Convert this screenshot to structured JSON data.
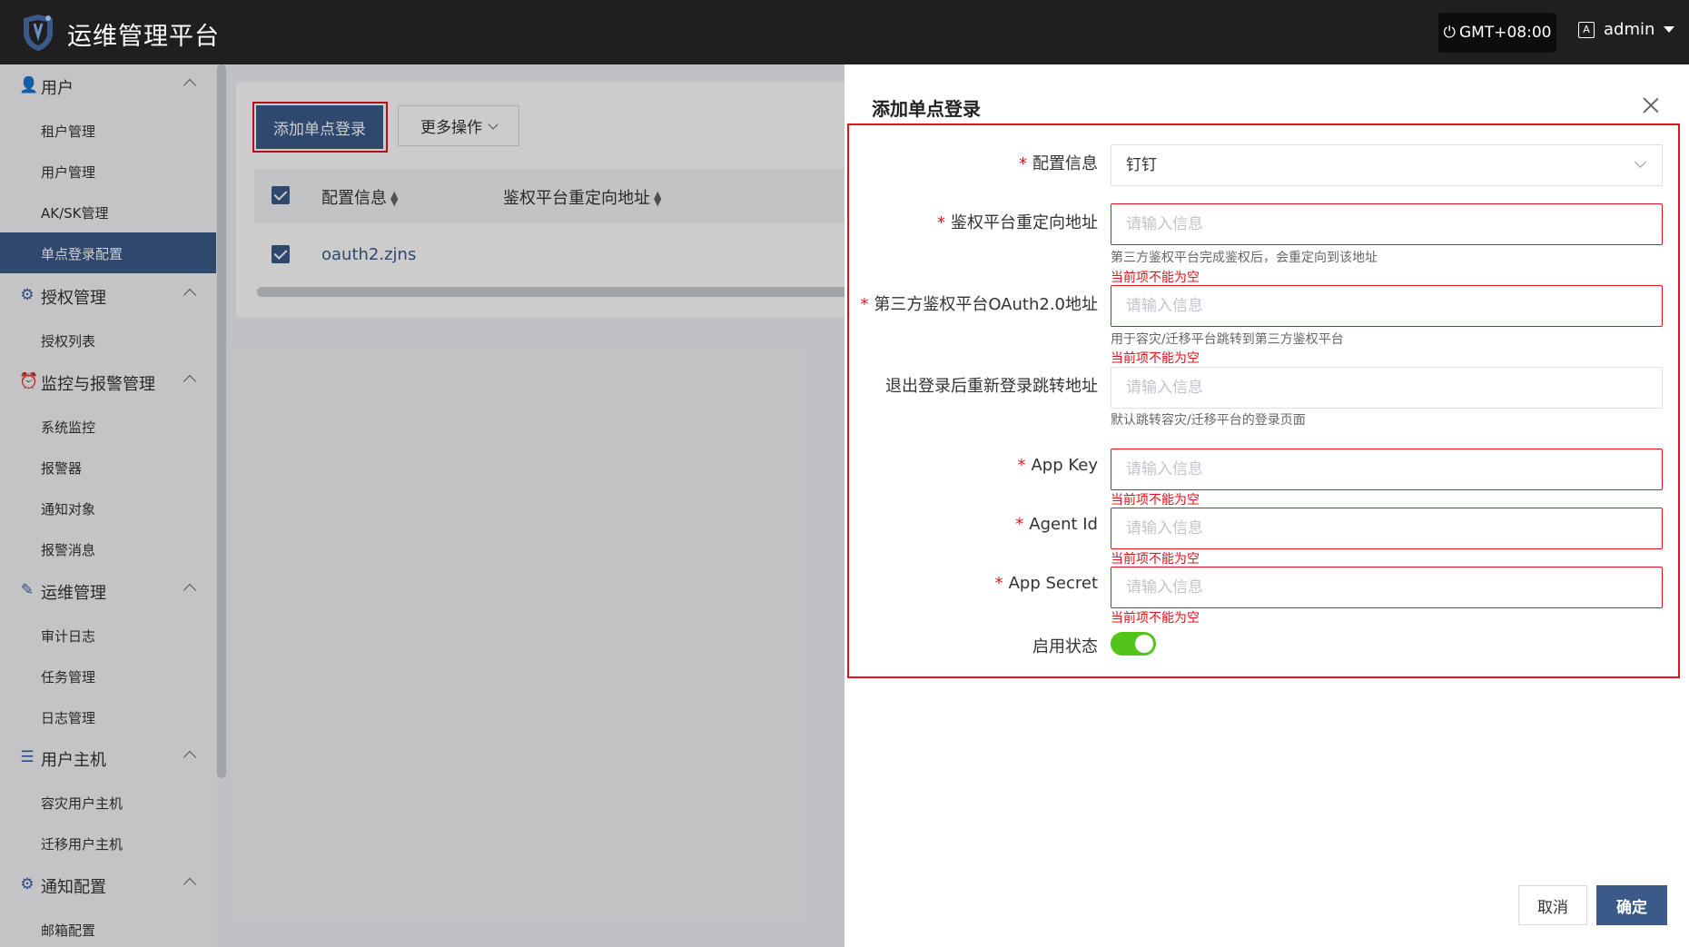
{
  "header": {
    "app_title": "运维管理平台",
    "timezone": "GMT+08:00",
    "user": "admin"
  },
  "sidebar": {
    "groups": [
      {
        "label": "用户",
        "icon": "user-icon",
        "items": [
          "租户管理",
          "用户管理",
          "AK/SK管理",
          "单点登录配置"
        ]
      },
      {
        "label": "授权管理",
        "icon": "key-gear-icon",
        "items": [
          "授权列表"
        ]
      },
      {
        "label": "监控与报警管理",
        "icon": "alarm-icon",
        "items": [
          "系统监控",
          "报警器",
          "通知对象",
          "报警消息"
        ]
      },
      {
        "label": "运维管理",
        "icon": "ops-icon",
        "items": [
          "审计日志",
          "任务管理",
          "日志管理"
        ]
      },
      {
        "label": "用户主机",
        "icon": "layers-icon",
        "items": [
          "容灾用户主机",
          "迁移用户主机"
        ]
      },
      {
        "label": "通知配置",
        "icon": "gear-icon",
        "items": [
          "邮箱配置"
        ]
      }
    ],
    "active_item": "单点登录配置"
  },
  "main": {
    "add_button": "添加单点登录",
    "more_button": "更多操作",
    "table": {
      "columns": [
        "配置信息",
        "鉴权平台重定向地址"
      ],
      "rows": [
        [
          "oauth2.zjns",
          ""
        ]
      ]
    }
  },
  "drawer": {
    "title": "添加单点登录",
    "fields": {
      "config": {
        "label": "配置信息",
        "value": "钉钉"
      },
      "redirect": {
        "label": "鉴权平台重定向地址",
        "placeholder": "请输入信息",
        "hint": "第三方鉴权平台完成鉴权后，会重定向到该地址",
        "error": "当前项不能为空"
      },
      "oauth": {
        "label": "第三方鉴权平台OAuth2.0地址",
        "placeholder": "请输入信息",
        "hint": "用于容灾/迁移平台跳转到第三方鉴权平台",
        "error": "当前项不能为空"
      },
      "logout": {
        "label": "退出登录后重新登录跳转地址",
        "placeholder": "请输入信息",
        "hint": "默认跳转容灾/迁移平台的登录页面"
      },
      "app_key": {
        "label": "App Key",
        "placeholder": "请输入信息",
        "error": "当前项不能为空"
      },
      "agent_id": {
        "label": "Agent Id",
        "placeholder": "请输入信息",
        "error": "当前项不能为空"
      },
      "app_secret": {
        "label": "App Secret",
        "placeholder": "请输入信息",
        "error": "当前项不能为空"
      },
      "enable": {
        "label": "启用状态",
        "on": true
      }
    },
    "required_mark": "*",
    "cancel": "取消",
    "confirm": "确定"
  },
  "colors": {
    "primary": "#3b5a8a",
    "error": "#e0141e",
    "switch_on": "#52c41a",
    "header_bg": "#1f1f1f"
  }
}
